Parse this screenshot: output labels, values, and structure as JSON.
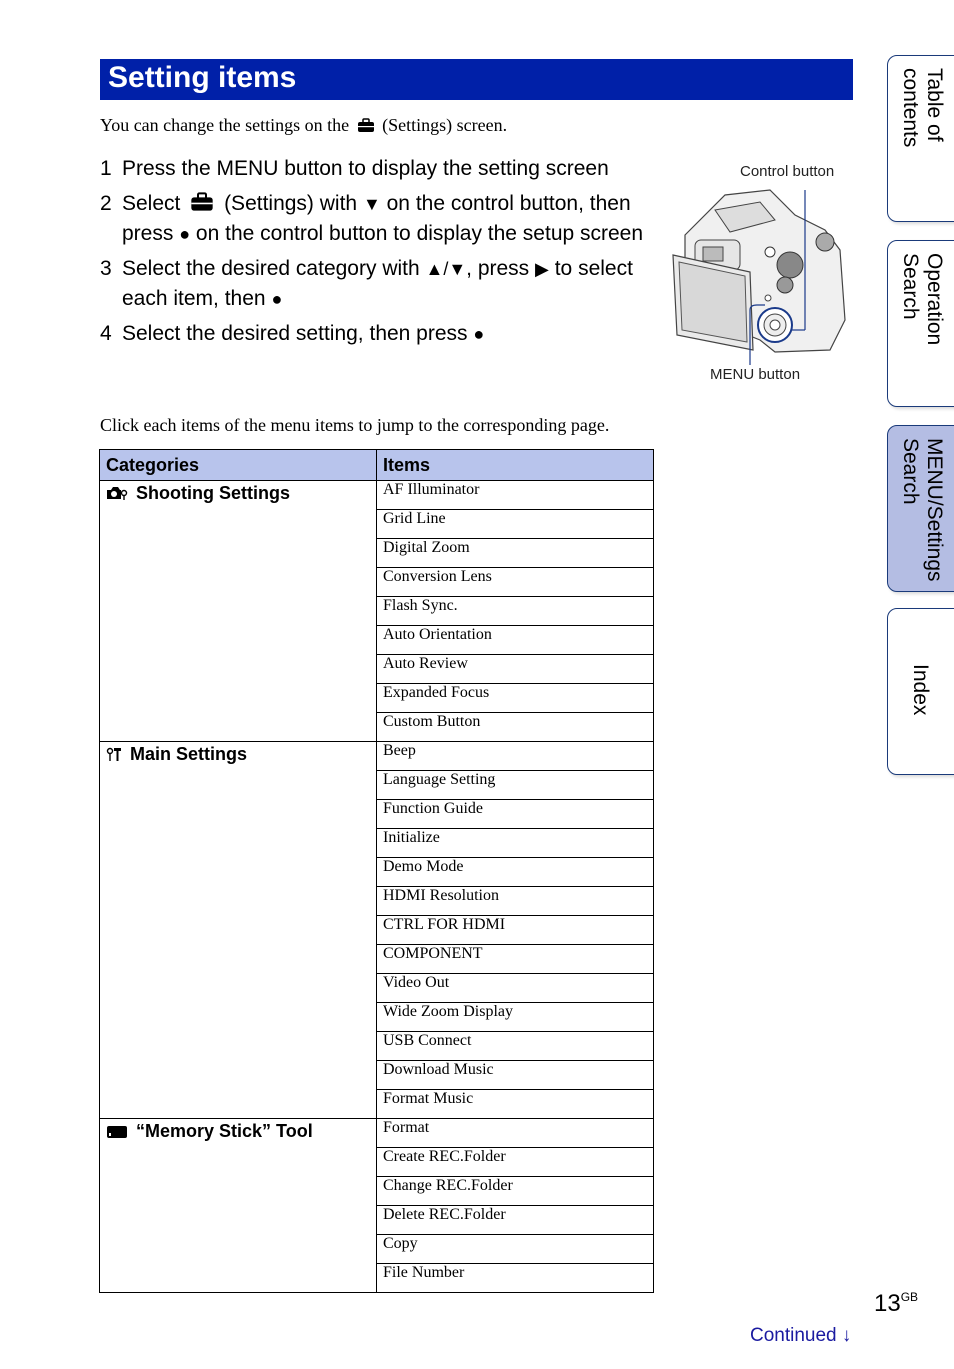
{
  "header": {
    "title": "Setting items"
  },
  "intro": {
    "before": "You can change the settings on the",
    "after": "(Settings) screen.",
    "icon": "settings-briefcase-icon"
  },
  "steps": [
    {
      "num": "1",
      "text": "Press the MENU button to display the setting screen"
    },
    {
      "num": "2",
      "part1": "Select",
      "part2": "(Settings) with",
      "down": "▼",
      "part3": "on the control button, then press",
      "dot": "●",
      "part4": "on the control button to display the setup screen"
    },
    {
      "num": "3",
      "part1": "Select the desired category with",
      "updown": "▲/▼",
      "part2": ", press",
      "right": "▶",
      "part3": "to select each item, then",
      "dot": "●"
    },
    {
      "num": "4",
      "text": "Select the desired setting, then press",
      "dot": "●"
    }
  ],
  "figure": {
    "control_label": "Control button",
    "menu_label": "MENU button"
  },
  "note": "Click each items of the menu items to jump to the corresponding page.",
  "table": {
    "headers": [
      "Categories",
      "Items"
    ],
    "groups": [
      {
        "category": "Shooting Settings",
        "icon": "camera-settings-icon",
        "items": [
          "AF Illuminator",
          "Grid Line",
          "Digital Zoom",
          "Conversion Lens",
          "Flash Sync.",
          "Auto Orientation",
          "Auto Review",
          "Expanded Focus",
          "Custom Button"
        ]
      },
      {
        "category": "Main Settings",
        "icon": "tools-icon",
        "items": [
          "Beep",
          "Language Setting",
          "Function Guide",
          "Initialize",
          "Demo Mode",
          "HDMI Resolution",
          "CTRL FOR HDMI",
          "COMPONENT",
          "Video Out",
          "Wide Zoom Display",
          "USB Connect",
          "Download Music",
          "Format Music"
        ]
      },
      {
        "category": "“Memory Stick” Tool",
        "icon": "memory-card-icon",
        "items": [
          "Format",
          "Create REC.Folder",
          "Change REC.Folder",
          "Delete REC.Folder",
          "Copy",
          "File Number"
        ]
      }
    ]
  },
  "side_tabs": [
    {
      "label": "Table of\ncontents",
      "active": false
    },
    {
      "label": "Operation\nSearch",
      "active": false
    },
    {
      "label": "MENU/Settings\nSearch",
      "active": true
    },
    {
      "label": "Index",
      "active": false
    }
  ],
  "footer": {
    "page": "13",
    "page_suffix": "GB",
    "continued": "Continued",
    "arrow": "↓"
  },
  "colors": {
    "title_bar": "#0020a8",
    "table_header": "#b8c4ec",
    "active_tab": "#b4bde3",
    "link": "#1a1aa0"
  }
}
